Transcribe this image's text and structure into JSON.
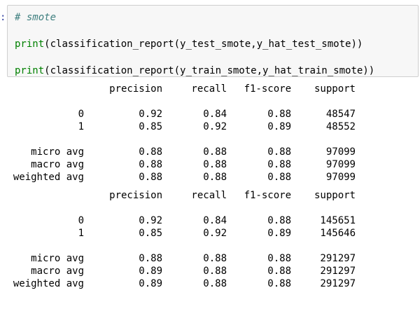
{
  "prompt": ":",
  "cell": {
    "comment": "# smote",
    "line1_fn": "print",
    "line1_rest": "(classification_report(y_test_smote,y_hat_test_smote))",
    "line2_fn": "print",
    "line2_rest": "(classification_report(y_train_smote,y_hat_train_smote))"
  },
  "reports": [
    {
      "headers": [
        "precision",
        "recall",
        "f1-score",
        "support"
      ],
      "classes": [
        {
          "label": "0",
          "precision": "0.92",
          "recall": "0.84",
          "f1": "0.88",
          "support": "48547"
        },
        {
          "label": "1",
          "precision": "0.85",
          "recall": "0.92",
          "f1": "0.89",
          "support": "48552"
        }
      ],
      "averages": [
        {
          "label": "micro avg",
          "precision": "0.88",
          "recall": "0.88",
          "f1": "0.88",
          "support": "97099"
        },
        {
          "label": "macro avg",
          "precision": "0.88",
          "recall": "0.88",
          "f1": "0.88",
          "support": "97099"
        },
        {
          "label": "weighted avg",
          "precision": "0.88",
          "recall": "0.88",
          "f1": "0.88",
          "support": "97099"
        }
      ]
    },
    {
      "headers": [
        "precision",
        "recall",
        "f1-score",
        "support"
      ],
      "classes": [
        {
          "label": "0",
          "precision": "0.92",
          "recall": "0.84",
          "f1": "0.88",
          "support": "145651"
        },
        {
          "label": "1",
          "precision": "0.85",
          "recall": "0.92",
          "f1": "0.89",
          "support": "145646"
        }
      ],
      "averages": [
        {
          "label": "micro avg",
          "precision": "0.88",
          "recall": "0.88",
          "f1": "0.88",
          "support": "291297"
        },
        {
          "label": "macro avg",
          "precision": "0.89",
          "recall": "0.88",
          "f1": "0.88",
          "support": "291297"
        },
        {
          "label": "weighted avg",
          "precision": "0.89",
          "recall": "0.88",
          "f1": "0.88",
          "support": "291297"
        }
      ]
    }
  ]
}
